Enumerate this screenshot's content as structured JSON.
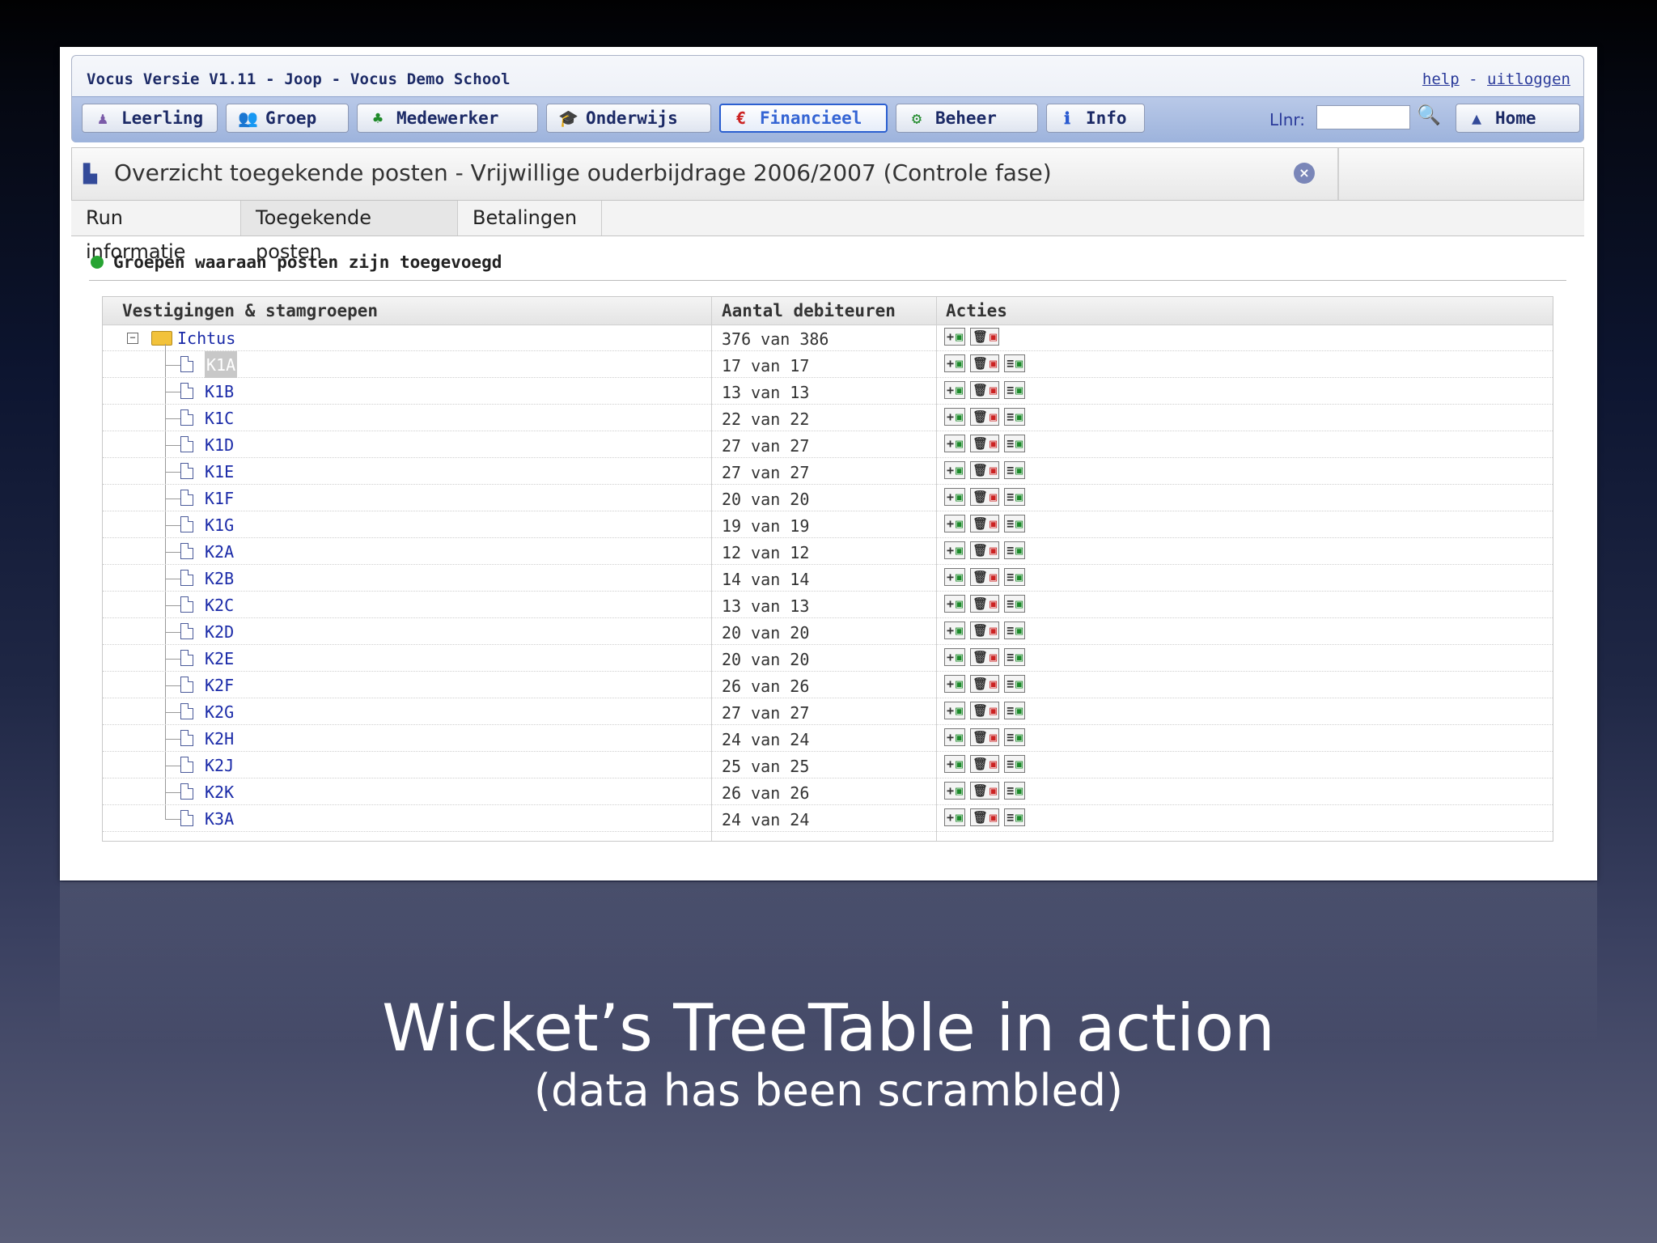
{
  "app": {
    "title": "Vocus Versie V1.11 - Joop - Vocus Demo School",
    "links": {
      "help": "help",
      "separator": "-",
      "logout": "uitloggen"
    }
  },
  "nav": {
    "buttons": [
      {
        "label": "Leerling",
        "icon": "person-icon"
      },
      {
        "label": "Groep",
        "icon": "group-icon"
      },
      {
        "label": "Medewerker",
        "icon": "org-icon"
      },
      {
        "label": "Onderwijs",
        "icon": "graduation-cap-icon"
      },
      {
        "label": "Financieel",
        "icon": "euro-icon",
        "active": true
      },
      {
        "label": "Beheer",
        "icon": "gears-icon"
      },
      {
        "label": "Info",
        "icon": "info-icon"
      }
    ],
    "llnr_label": "Llnr:",
    "llnr_value": "",
    "home_label": "Home"
  },
  "panel": {
    "title": "Overzicht toegekende posten - Vrijwillige ouderbijdrage 2006/2007 (Controle fase)",
    "tabs": [
      {
        "label": "Run informatie"
      },
      {
        "label": "Toegekende posten",
        "active": true
      },
      {
        "label": "Betalingen"
      }
    ],
    "section_title": "Groepen waaraan posten zijn toegevoegd"
  },
  "table": {
    "headers": [
      "Vestigingen & stamgroepen",
      "Aantal debiteuren",
      "Acties"
    ],
    "root": {
      "name": "Ichtus",
      "count": "376 van 386"
    },
    "rows": [
      {
        "name": "K1A",
        "count": "17 van 17",
        "selected": true
      },
      {
        "name": "K1B",
        "count": "13 van 13"
      },
      {
        "name": "K1C",
        "count": "22 van 22"
      },
      {
        "name": "K1D",
        "count": "27 van 27"
      },
      {
        "name": "K1E",
        "count": "27 van 27"
      },
      {
        "name": "K1F",
        "count": "20 van 20"
      },
      {
        "name": "K1G",
        "count": "19 van 19"
      },
      {
        "name": "K2A",
        "count": "12 van 12"
      },
      {
        "name": "K2B",
        "count": "14 van 14"
      },
      {
        "name": "K2C",
        "count": "13 van 13"
      },
      {
        "name": "K2D",
        "count": "20 van 20"
      },
      {
        "name": "K2E",
        "count": "20 van 20"
      },
      {
        "name": "K2F",
        "count": "26 van 26"
      },
      {
        "name": "K2G",
        "count": "27 van 27"
      },
      {
        "name": "K2H",
        "count": "24 van 24"
      },
      {
        "name": "K2J",
        "count": "25 van 25"
      },
      {
        "name": "K2K",
        "count": "26 van 26"
      },
      {
        "name": "K3A",
        "count": "24 van 24"
      }
    ]
  },
  "caption": {
    "main": "Wicket’s TreeTable in action",
    "sub": "(data has been scrambled)"
  }
}
